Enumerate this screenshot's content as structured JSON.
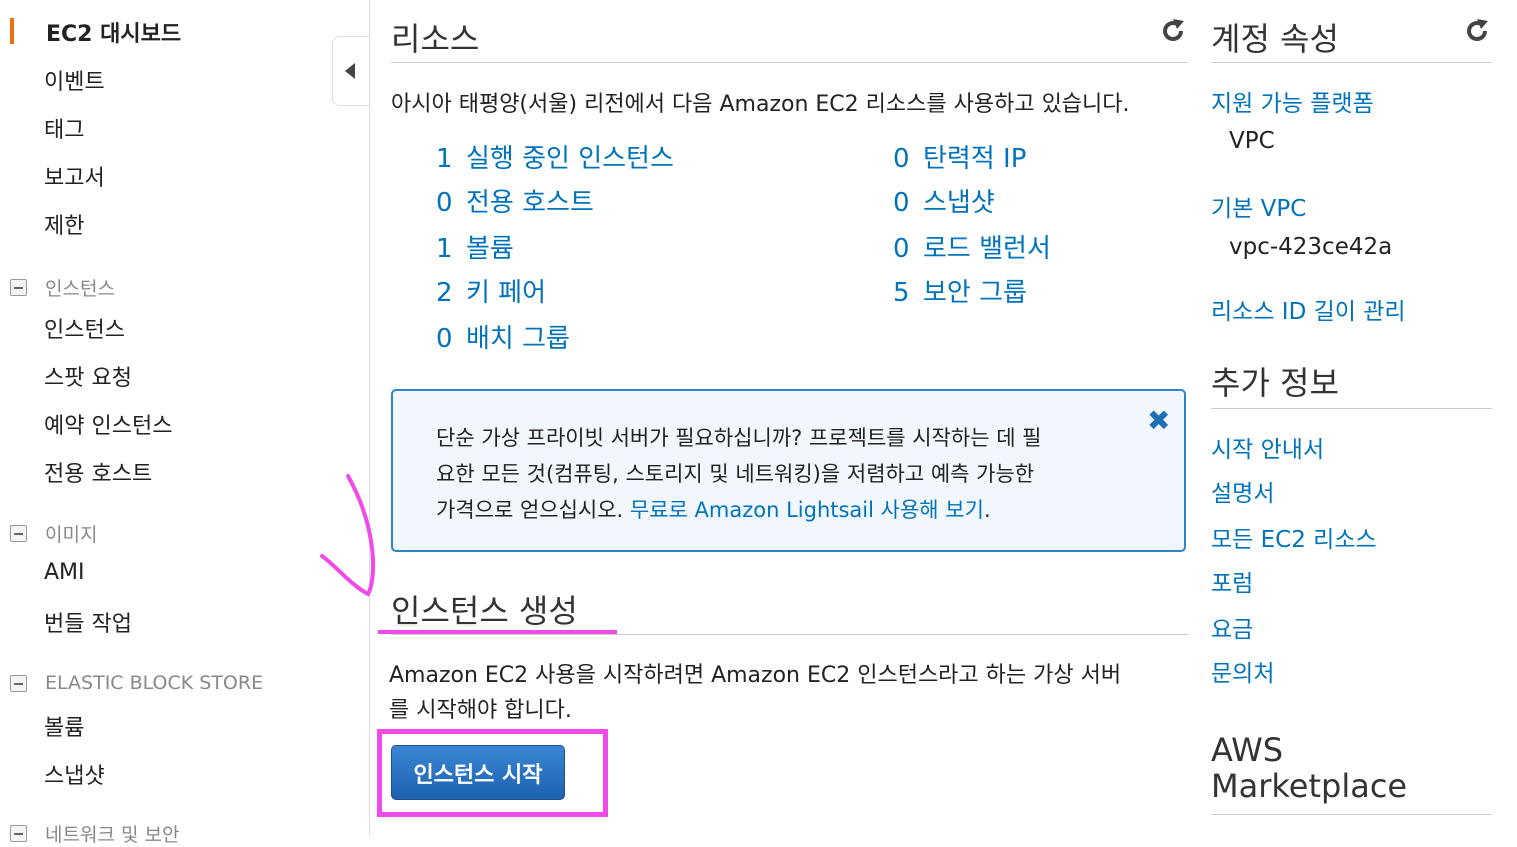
{
  "sidebar": {
    "active": "EC2 대시보드",
    "top_items": [
      "이벤트",
      "태그",
      "보고서",
      "제한"
    ],
    "sections": [
      {
        "title": "인스턴스",
        "items": [
          "인스턴스",
          "스팟 요청",
          "예약 인스턴스",
          "전용 호스트"
        ]
      },
      {
        "title": "이미지",
        "items": [
          "AMI",
          "번들 작업"
        ]
      },
      {
        "title": "ELASTIC BLOCK STORE",
        "items": [
          "볼륨",
          "스냅샷"
        ]
      },
      {
        "title": "네트워크 및 보안"
      }
    ]
  },
  "resources": {
    "title": "리소스",
    "description": "아시아 태평양(서울) 리전에서 다음 Amazon EC2 리소스를 사용하고 있습니다.",
    "left": [
      {
        "count": "1",
        "label": "실행 중인 인스턴스"
      },
      {
        "count": "0",
        "label": "전용 호스트"
      },
      {
        "count": "1",
        "label": "볼륨"
      },
      {
        "count": "2",
        "label": "키 페어"
      },
      {
        "count": "0",
        "label": "배치 그룹"
      }
    ],
    "right": [
      {
        "count": "0",
        "label": "탄력적 IP"
      },
      {
        "count": "0",
        "label": "스냅샷"
      },
      {
        "count": "0",
        "label": "로드 밸런서"
      },
      {
        "count": "5",
        "label": "보안 그룹"
      }
    ]
  },
  "lightsail_notice": {
    "line1": "단순 가상 프라이빗 서버가 필요하십니까? 프로젝트를 시작하는 데 필",
    "line2": "요한 모든 것(컴퓨팅, 스토리지 및 네트워킹)을 저렴하고 예측 가능한",
    "line3_prefix": "가격으로 얻으십시오. ",
    "link": "무료로 Amazon Lightsail 사용해 보기",
    "line3_suffix": ".",
    "close_glyph": "✖"
  },
  "create_instance": {
    "title": "인스턴스 생성",
    "desc_line1": "Amazon EC2 사용을 시작하려면 Amazon EC2 인스턴스라고 하는 가상 서버",
    "desc_line2": "를 시작해야 합니다.",
    "button": "인스턴스 시작"
  },
  "account": {
    "title": "계정 속성",
    "platforms_label": "지원 가능 플랫폼",
    "platforms_value": "VPC",
    "default_vpc_label": "기본 VPC",
    "default_vpc_value": "vpc-423ce42a",
    "resource_id_link": "리소스 ID 길이 관리"
  },
  "additional_info": {
    "title": "추가 정보",
    "links": [
      "시작 안내서",
      "설명서",
      "모든 EC2 리소스",
      "포럼",
      "요금",
      "문의처"
    ]
  },
  "marketplace": {
    "line1": "AWS",
    "line2": "Marketplace"
  },
  "colors": {
    "link": "#0073bb",
    "active_bar": "#ec7211",
    "annotation": "#f04be8",
    "button": "#1d61b1"
  }
}
